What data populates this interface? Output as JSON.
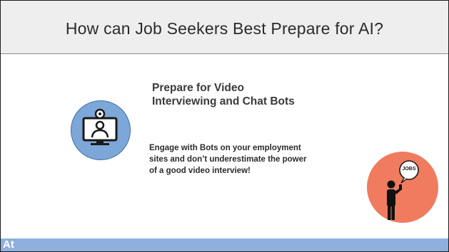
{
  "slide": {
    "title": "How can Job Seekers Best Prepare for AI?",
    "subtitle_line1": "Prepare for Video",
    "subtitle_line2": "Interviewing and Chat Bots",
    "body_line1": "Engage with Bots on your employment",
    "body_line2": "sites and don’t underestimate the power",
    "body_line3": "of a good video interview!",
    "jobs_bubble_text": "JOBS",
    "footer_text": "At"
  },
  "icons": {
    "video": "video-interview-icon",
    "jobs": "job-seeker-phone-icon"
  },
  "colors": {
    "title_band": "#eeeeee",
    "video_circle": "#7da7d8",
    "jobs_circle": "#f07b5f",
    "footer_bar": "#8fb0de"
  }
}
